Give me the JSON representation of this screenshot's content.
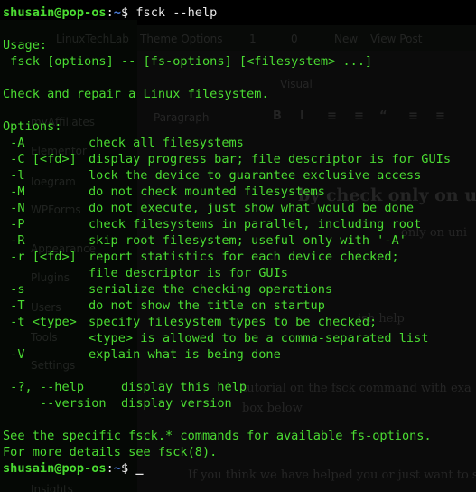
{
  "background": {
    "sidebar_items": [
      "myAffiliates",
      "Elementor",
      "Ioegram",
      "WPForms",
      "Appearance",
      "Plugins",
      "Users",
      "Tools",
      "Settings",
      "Insights"
    ],
    "topbar_items": [
      "LinuxTechLab",
      "Theme Options",
      "1",
      "0",
      "New",
      "View Post"
    ],
    "editor_fragments": [
      "by check only on un",
      "only on uni",
      "ish help",
      "tutorial on the fsck command with exa",
      "box below",
      "If you think we have helped you or just want to su",
      "Paragraph",
      "Visual"
    ],
    "toolbar_glyphs": [
      "B",
      "I",
      "≡",
      "≡",
      "“",
      "≡",
      "≡"
    ]
  },
  "terminal": {
    "prompt": {
      "user_host": "shusain@pop-os",
      "sep": ":",
      "path": "~",
      "symbol": "$"
    },
    "command": "fsck --help",
    "usage_header": "Usage:",
    "usage_line": " fsck [options] -- [fs-options] [<filesystem> ...]",
    "description": "Check and repair a Linux filesystem.",
    "options_header": "Options:",
    "options": [
      {
        "flag": " -A",
        "desc": "check all filesystems"
      },
      {
        "flag": " -C [<fd>]",
        "desc": "display progress bar; file descriptor is for GUIs"
      },
      {
        "flag": " -l",
        "desc": "lock the device to guarantee exclusive access"
      },
      {
        "flag": " -M",
        "desc": "do not check mounted filesystems"
      },
      {
        "flag": " -N",
        "desc": "do not execute, just show what would be done"
      },
      {
        "flag": " -P",
        "desc": "check filesystems in parallel, including root"
      },
      {
        "flag": " -R",
        "desc": "skip root filesystem; useful only with '-A'"
      },
      {
        "flag": " -r [<fd>]",
        "desc": "report statistics for each device checked;"
      },
      {
        "flag": "",
        "desc": "file descriptor is for GUIs"
      },
      {
        "flag": " -s",
        "desc": "serialize the checking operations"
      },
      {
        "flag": " -T",
        "desc": "do not show the title on startup"
      },
      {
        "flag": " -t <type>",
        "desc": "specify filesystem types to be checked;"
      },
      {
        "flag": "",
        "desc": "<type> is allowed to be a comma-separated list"
      },
      {
        "flag": " -V",
        "desc": "explain what is being done"
      }
    ],
    "help_line": " -?, --help     display this help",
    "version_line": "     --version  display version",
    "see_line": "See the specific fsck.* commands for available fs-options.",
    "details_line": "For more details see fsck(8).",
    "cursor": "_"
  }
}
